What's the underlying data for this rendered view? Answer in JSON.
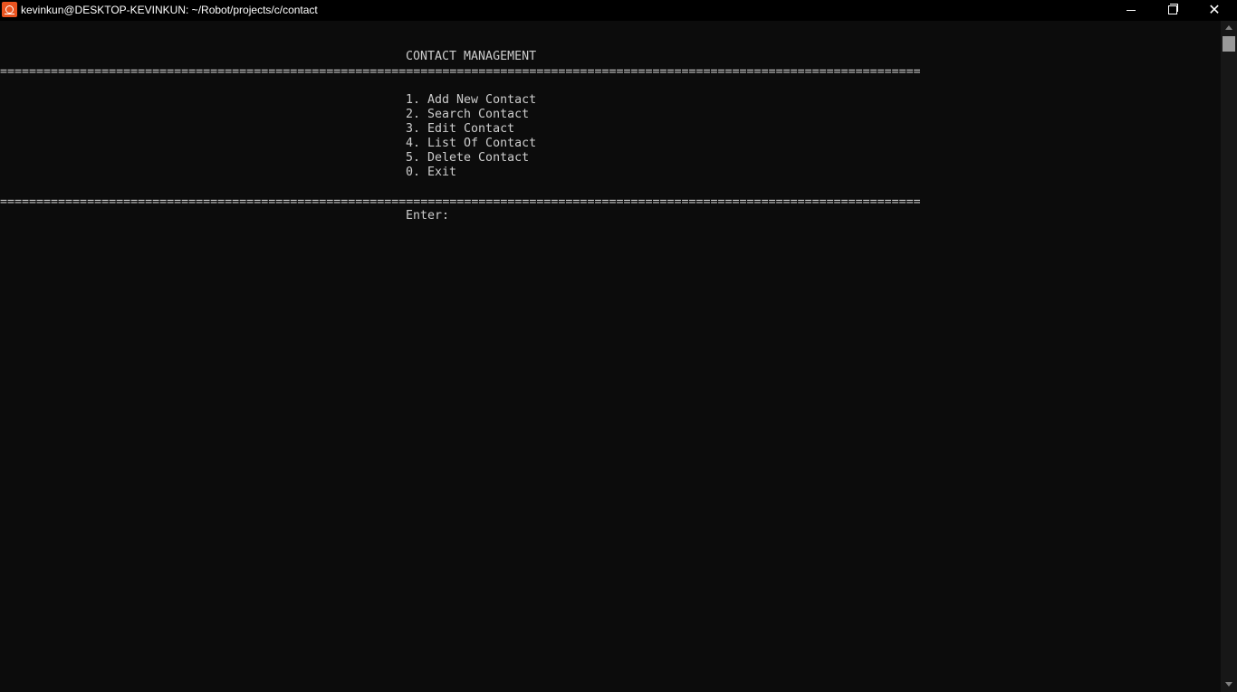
{
  "window": {
    "title": "kevinkun@DESKTOP-KEVINKUN: ~/Robot/projects/c/contact",
    "icon": "ubuntu-terminal-icon",
    "controls": {
      "minimize": "minimize-icon",
      "maximize": "restore-icon",
      "close": "close-icon"
    }
  },
  "terminal": {
    "header": "CONTACT MANAGEMENT",
    "separator": "=====================================================================================================================================",
    "menu": [
      "1. Add New Contact",
      "2. Search Contact",
      "3. Edit Contact",
      "4. List Of Contact",
      "5. Delete Contact",
      "0. Exit"
    ],
    "prompt": "Enter:"
  },
  "colors": {
    "background": "#0c0c0c",
    "text": "#cccccc",
    "titlebar": "#000000",
    "icon_accent": "#e95420"
  }
}
